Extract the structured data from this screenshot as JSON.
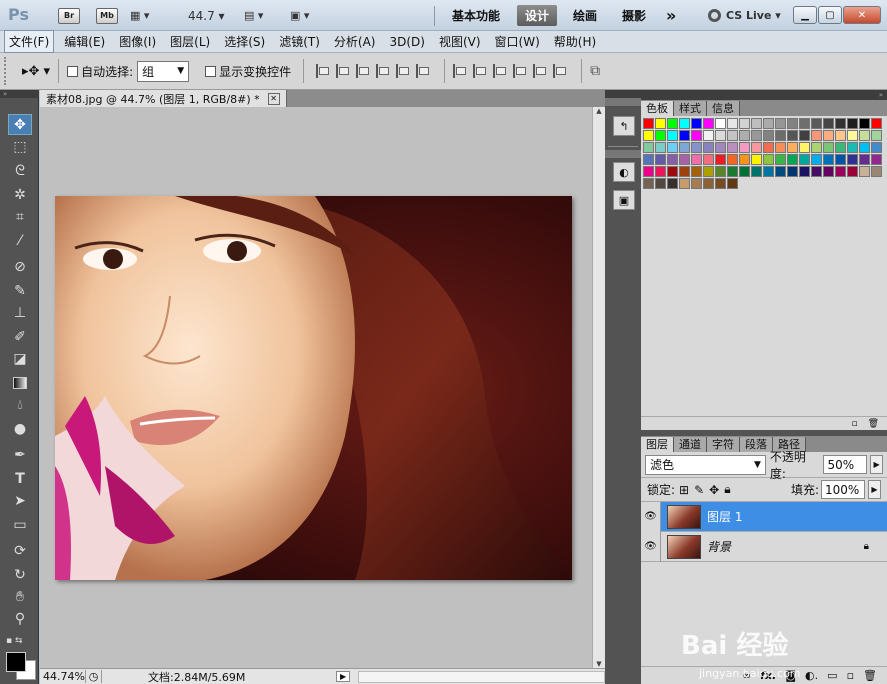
{
  "titlebar": {
    "logo": "Ps",
    "br": "Br",
    "mb": "Mb",
    "zoom": "44.7",
    "workspaces": [
      "基本功能",
      "设计",
      "绘画",
      "摄影"
    ],
    "active_workspace": "设计",
    "more": "»",
    "cslive": "CS Live"
  },
  "menu": [
    "文件(F)",
    "编辑(E)",
    "图像(I)",
    "图层(L)",
    "选择(S)",
    "滤镜(T)",
    "分析(A)",
    "3D(D)",
    "视图(V)",
    "窗口(W)",
    "帮助(H)"
  ],
  "options": {
    "auto_select": "自动选择:",
    "group": "组",
    "show_transform": "显示变换控件"
  },
  "document": {
    "tab_title": "素材08.jpg @ 44.7% (图层 1, RGB/8#) *",
    "close": "✕"
  },
  "status": {
    "zoom": "44.74%",
    "doc_size": "文档:2.84M/5.69M"
  },
  "swatches_panel": {
    "tabs": [
      "色板",
      "样式",
      "信息"
    ],
    "active": "色板"
  },
  "layers_panel": {
    "tabs": [
      "图层",
      "通道",
      "字符",
      "段落",
      "路径"
    ],
    "active": "图层",
    "blend_mode": "滤色",
    "opacity_label": "不透明度:",
    "opacity": "50%",
    "lock_label": "锁定:",
    "fill_label": "填充:",
    "fill": "100%",
    "layers": [
      {
        "name": "图层 1",
        "selected": true
      },
      {
        "name": "背景",
        "selected": false,
        "locked": true
      }
    ]
  },
  "watermark": {
    "brand": "Bai 经验",
    "url": "jingyan.baidu.com"
  },
  "colors": {
    "accent": "#3f8ee6",
    "panel_bg": "#535353"
  }
}
